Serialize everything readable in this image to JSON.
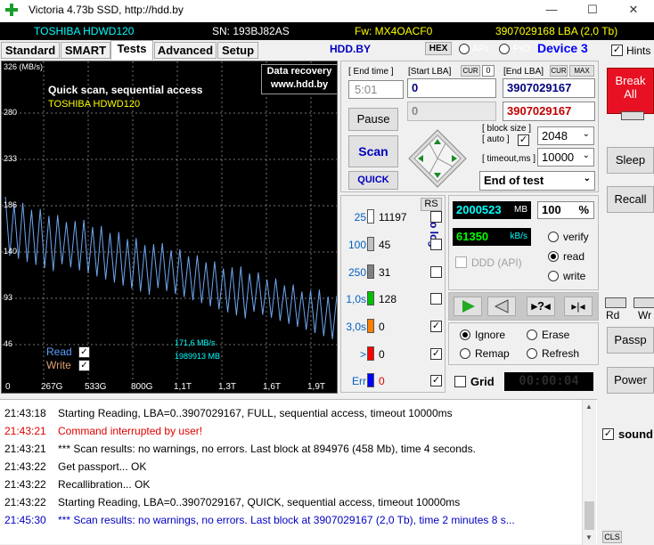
{
  "window": {
    "title": "Victoria 4.73b SSD, http://hdd.by",
    "minimize": "—",
    "maximize": "☐",
    "close": "✕"
  },
  "infobar": {
    "model": "TOSHIBA HDWD120",
    "serial": "SN: 193BJ82AS",
    "firmware": "Fw: MX4OACF0",
    "capacity": "3907029168 LBA (2,0 Tb)"
  },
  "tabs": [
    "Standard",
    "SMART",
    "Tests",
    "Advanced",
    "Setup"
  ],
  "header": {
    "site": "HDD.BY",
    "hex": "HEX",
    "api": "API",
    "pio": "PIO",
    "device": "Device 3",
    "hints": "Hints"
  },
  "graph": {
    "ymax_label": "326 (MB/s)",
    "yticks": [
      "280",
      "233",
      "186",
      "140",
      "93",
      "46"
    ],
    "xticks": [
      "0",
      "267G",
      "533G",
      "800G",
      "1,1T",
      "1,3T",
      "1,6T",
      "1,9T"
    ],
    "title": "Quick scan, sequential access",
    "model": "TOSHIBA HDWD120",
    "data_recovery": "Data recovery",
    "data_recovery_url": "www.hdd.by",
    "legend_read": "Read",
    "legend_write": "Write",
    "speed": "171,6 MB/s",
    "position": "1989913 MB"
  },
  "controls": {
    "end_time_label": "[ End time ]",
    "end_time": "5:01",
    "start_lba_label": "[Start LBA]",
    "cur": "CUR",
    "start_cur_value": "0",
    "end_lba_label": "[End LBA]",
    "max": "MAX",
    "start_lba": "0",
    "end_lba": "3907029167",
    "start_lba2": "0",
    "end_lba2": "3907029167",
    "pause": "Pause",
    "scan": "Scan",
    "quick": "QUICK",
    "block_size_label": "[ block size ]",
    "auto_label": "[ auto ]",
    "block_size": "2048",
    "timeout_label": "[ timeout,ms ]",
    "timeout": "10000",
    "end_mode": "End of test"
  },
  "stats": {
    "rs": "RS",
    "to_log": "to log:",
    "rows": [
      {
        "label": "25",
        "count": "11197",
        "color": "#ffffff"
      },
      {
        "label": "100",
        "count": "45",
        "color": "#c0c0c0"
      },
      {
        "label": "250",
        "count": "31",
        "color": "#808080"
      },
      {
        "label": "1,0s",
        "count": "128",
        "color": "#00c000"
      },
      {
        "label": "3,0s",
        "count": "0",
        "color": "#ff8000"
      },
      {
        "label": ">",
        "count": "0",
        "color": "#ff0000"
      },
      {
        "label": "Err",
        "count": "0",
        "color": "#0000ff"
      }
    ]
  },
  "progress": {
    "mb": "2000523",
    "mb_unit": "MB",
    "percent": "100",
    "percent_unit": "%",
    "speed": "61350",
    "speed_unit": "kB/s",
    "ddd": "DDD (API)",
    "verify": "verify",
    "read": "read",
    "write": "write"
  },
  "actions": {
    "ignore": "Ignore",
    "erase": "Erase",
    "remap": "Remap",
    "refresh": "Refresh",
    "grid": "Grid",
    "timer": "00:00:04"
  },
  "side": {
    "break_all": "Break All",
    "sleep": "Sleep",
    "recall": "Recall",
    "rd": "Rd",
    "wr": "Wr",
    "passp": "Passp",
    "power": "Power",
    "sound": "sound",
    "cls": "CLS"
  },
  "log": [
    {
      "time": "21:43:18",
      "text": "Starting Reading, LBA=0..3907029167, FULL, sequential access, timeout 10000ms",
      "color": "#000000"
    },
    {
      "time": "21:43:21",
      "text": "Command interrupted by user!",
      "color": "#e00000"
    },
    {
      "time": "21:43:21",
      "text": "*** Scan results: no warnings, no errors. Last block at 894976 (458 Mb), time 4 seconds.",
      "color": "#000000"
    },
    {
      "time": "21:43:22",
      "text": "Get passport... OK",
      "color": "#000000"
    },
    {
      "time": "21:43:22",
      "text": "Recallibration... OK",
      "color": "#000000"
    },
    {
      "time": "21:43:22",
      "text": "Starting Reading, LBA=0..3907029167, QUICK, sequential access, timeout 10000ms",
      "color": "#000000"
    },
    {
      "time": "21:45:30",
      "text": "*** Scan results: no warnings, no errors. Last block at 3907029167 (2,0 Tb), time 2 minutes 8 s...",
      "color": "#0000c0"
    }
  ],
  "colors": {
    "graph_line": "#6ea6f0",
    "title_text": "#ffffff",
    "model_text": "#ffff00",
    "infobar_blue": "#00ffff",
    "infobar_yellow": "#ffff00",
    "break_red": "#e81123"
  }
}
